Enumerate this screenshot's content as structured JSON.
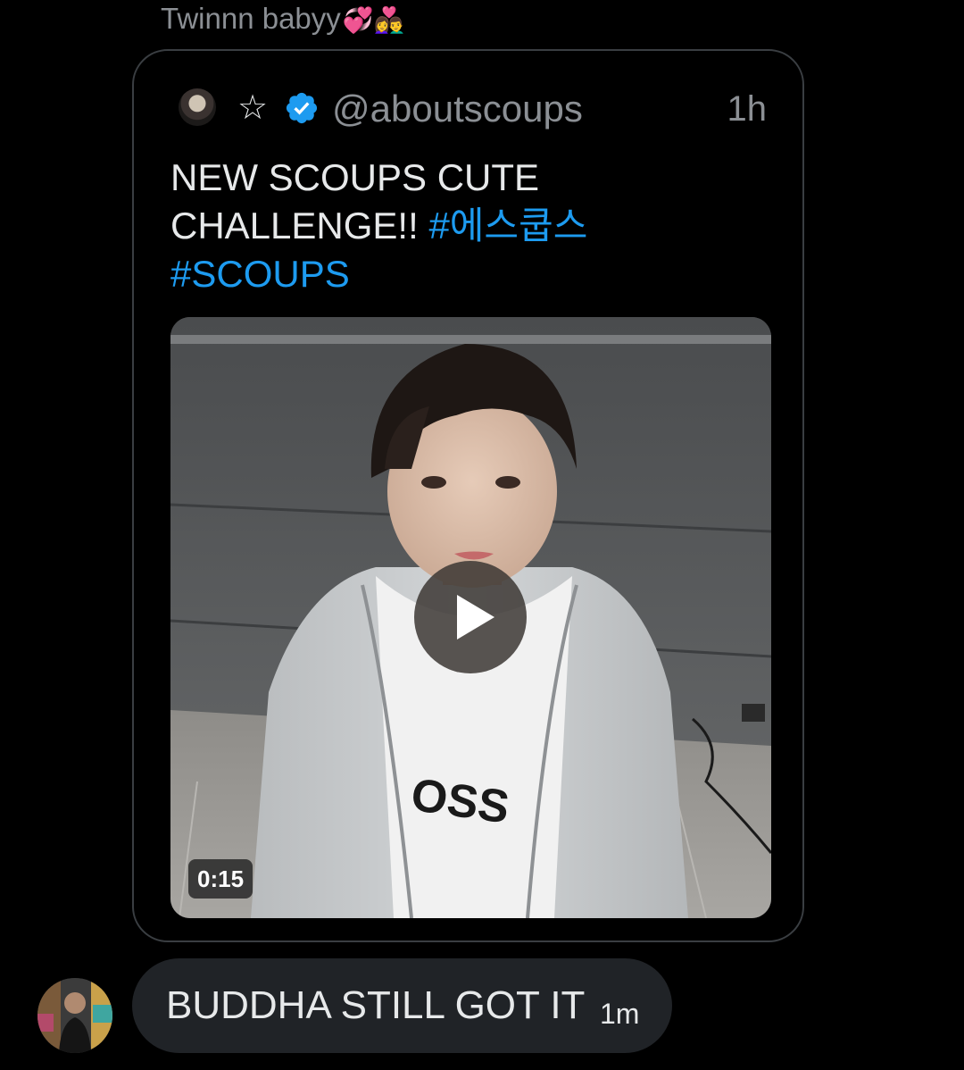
{
  "caption": {
    "text": "Twinnn babyy",
    "emoji": "💞👩‍❤️‍👨"
  },
  "quoted_post": {
    "star_glyph": "☆",
    "handle": "@aboutscoups",
    "timestamp": "1h",
    "text_plain": "NEW SCOUPS CUTE CHALLENGE!! ",
    "hashtag_1": "#에스쿱스",
    "hashtag_2": "#SCOUPS",
    "media": {
      "duration": "0:15",
      "shirt_text": "OSS"
    }
  },
  "reply": {
    "text": "BUDDHA STILL GOT IT",
    "timestamp": "1m"
  },
  "colors": {
    "background": "#000000",
    "text_primary": "#e7e9ea",
    "text_secondary": "#8b8f94",
    "link": "#1d9bf0",
    "card_border": "#3a3e42",
    "bubble": "#202327"
  }
}
